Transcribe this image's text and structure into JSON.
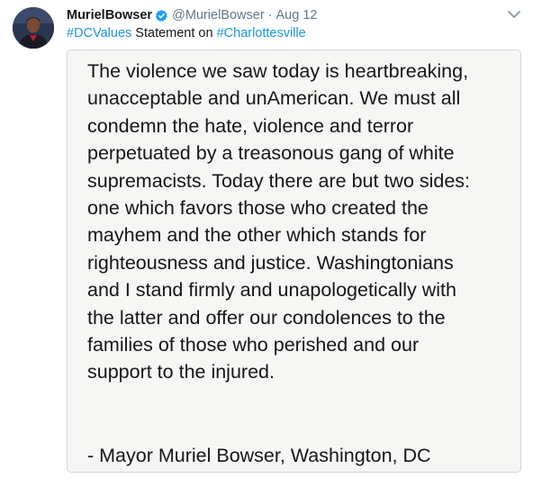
{
  "tweet": {
    "author_name": "MurielBowser",
    "handle": "@MurielBowser",
    "separator": "·",
    "date": "Aug 12",
    "text_prefix_hashtag": "#DCValues",
    "text_middle": " Statement on ",
    "text_suffix_hashtag": "#Charlottesville",
    "icons": {
      "verified": "verified-badge-icon",
      "menu": "chevron-down-icon",
      "avatar": "avatar"
    },
    "colors": {
      "link": "#1b95e0",
      "verified": "#1da1f2",
      "secondary_text": "#657786"
    }
  },
  "statement": {
    "lines": [
      "The violence we saw today is heartbreaking,",
      "unacceptable and unAmerican. We must all",
      "condemn the hate, violence and terror",
      "perpetuated by a treasonous gang of white",
      "supremacists. Today there are but two sides:",
      "one which favors those who created the",
      "mayhem and the other which stands for",
      "righteousness and justice. Washingtonians",
      "and I stand firmly and unapologetically with",
      "the latter and offer our condolences to the",
      "families of those who perished and our",
      "support to the injured."
    ],
    "signature": "- Mayor Muriel Bowser, Washington, DC"
  }
}
